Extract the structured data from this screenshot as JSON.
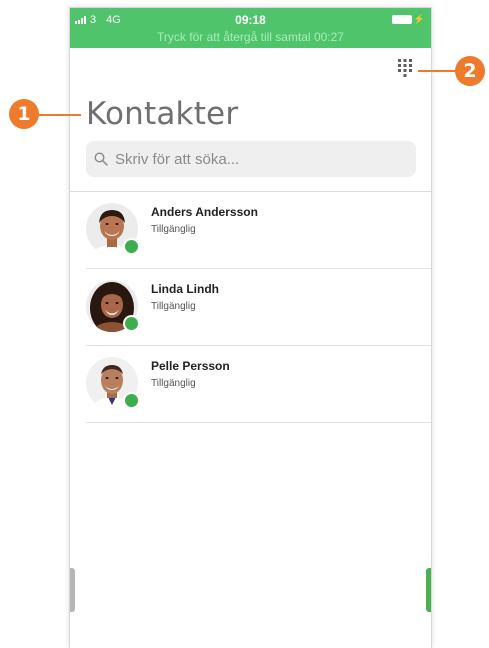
{
  "status_bar": {
    "carrier": "3",
    "network": "4G",
    "time": "09:18",
    "return_to_call": "Tryck för att återgå till samtal 00:27",
    "bar_color": "#4fc46a"
  },
  "header": {
    "title": "Kontakter",
    "dialpad_icon": "dialpad-icon"
  },
  "search": {
    "placeholder": "Skriv för att söka...",
    "value": "",
    "icon": "search-icon"
  },
  "contacts": [
    {
      "name": "Anders Andersson",
      "status": "Tillgänglig"
    },
    {
      "name": "Linda Lindh",
      "status": "Tillgänglig"
    },
    {
      "name": "Pelle Persson",
      "status": "Tillgänglig"
    }
  ],
  "annotations": {
    "title_callout": "1",
    "dialpad_callout": "2"
  },
  "colors": {
    "accent": "#4fc46a",
    "online": "#3cae4d",
    "callout": "#ee7a2c"
  }
}
